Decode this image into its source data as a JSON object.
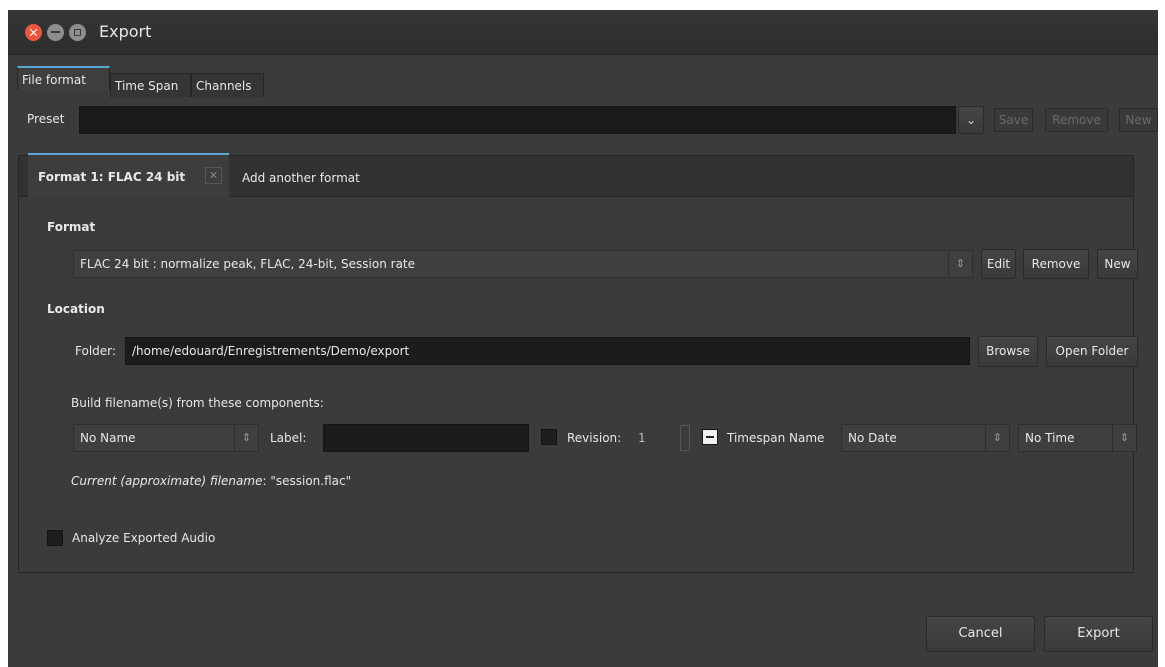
{
  "window": {
    "title": "Export"
  },
  "tabs": [
    {
      "label": "File format",
      "active": true
    },
    {
      "label": "Time Span",
      "active": false
    },
    {
      "label": "Channels",
      "active": false
    }
  ],
  "preset": {
    "label": "Preset",
    "value": "",
    "save_label": "Save",
    "remove_label": "Remove",
    "new_label": "New"
  },
  "format_tabs": {
    "active_label": "Format 1: FLAC 24 bit",
    "add_label": "Add another format"
  },
  "format": {
    "heading": "Format",
    "selected": "FLAC 24 bit : normalize peak, FLAC, 24-bit, Session rate",
    "edit_label": "Edit",
    "remove_label": "Remove",
    "new_label": "New"
  },
  "location": {
    "heading": "Location",
    "folder_label": "Folder:",
    "folder_value": "/home/edouard/Enregistrements/Demo/export",
    "browse_label": "Browse",
    "open_folder_label": "Open Folder"
  },
  "filename": {
    "build_label": "Build filename(s) from these components:",
    "name_select": "No Name",
    "label_label": "Label:",
    "label_value": "",
    "revision_label": "Revision:",
    "revision_value": "1",
    "timespan_label": "Timespan Name",
    "date_select": "No Date",
    "time_select": "No Time",
    "current_prefix": "Current (approximate) filename",
    "current_value": ": \"session.flac\""
  },
  "analyze": {
    "label": "Analyze Exported Audio",
    "checked": false
  },
  "footer": {
    "cancel_label": "Cancel",
    "export_label": "Export"
  },
  "colors": {
    "accent": "#5aa6d6",
    "close_button": "#e9573f",
    "background": "#3b3b3b"
  }
}
